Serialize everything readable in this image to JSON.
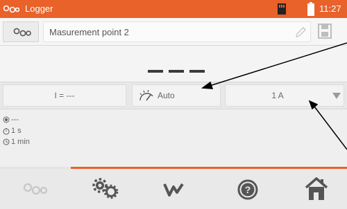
{
  "titlebar": {
    "title": "Logger",
    "clock": "11:27",
    "icons": [
      "logger-icon",
      "sd-card-icon",
      "battery-icon"
    ]
  },
  "namebar": {
    "name": "Masurement point 2",
    "icons": [
      "logger-icon",
      "pencil-icon",
      "save-icon"
    ]
  },
  "result": {
    "value": "---"
  },
  "params": {
    "current": "I = ---",
    "mode": "Auto",
    "range": "1 A"
  },
  "status": {
    "line1": "---",
    "line2": "1 s",
    "line3": "1 min",
    "icons": [
      "record-dot-icon",
      "stopwatch-icon",
      "clock-icon"
    ]
  },
  "toolbar": {
    "items": [
      "logger-icon",
      "settings-gears-icon",
      "waveform-icon",
      "help-icon",
      "home-icon"
    ]
  },
  "colors": {
    "accent": "#e8622a",
    "toolbar_bg": "#e9e9e9",
    "icon_gray": "#555555"
  }
}
